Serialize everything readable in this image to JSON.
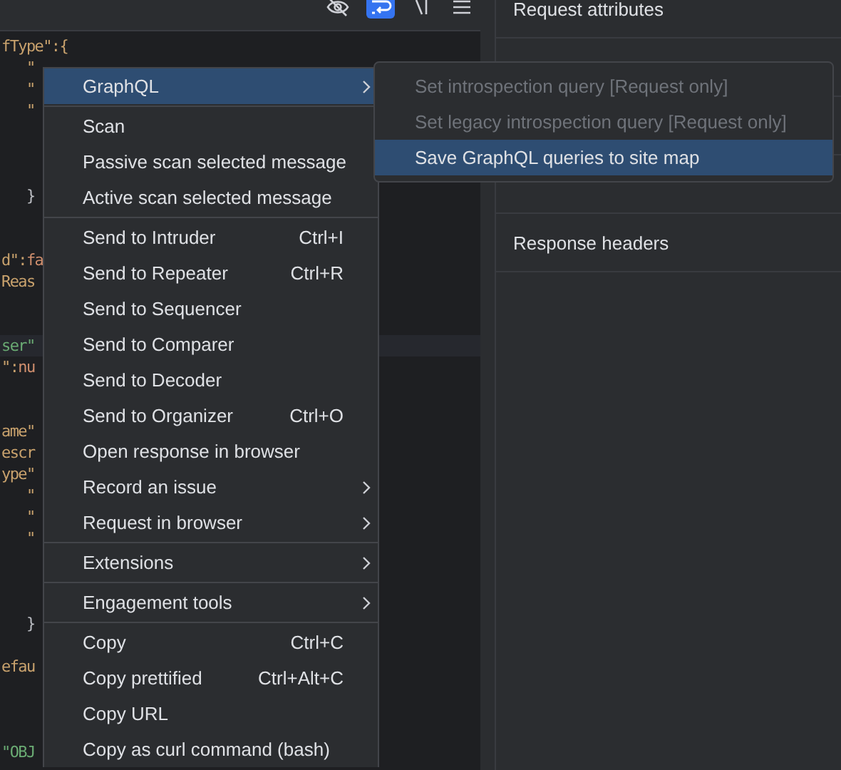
{
  "toolbar": [
    {
      "kind": "eye-off",
      "selected": false
    },
    {
      "kind": "wrap",
      "selected": true
    },
    {
      "kind": "newline",
      "selected": false
    },
    {
      "kind": "menu",
      "selected": false
    }
  ],
  "code_lines": [
    {
      "kind": "code",
      "current": false,
      "segments": [
        {
          "text": "fType\":{",
          "color": "#c9a26d"
        }
      ]
    },
    {
      "kind": "code",
      "current": false,
      "segments": [
        {
          "text": "   \"",
          "color": "#c9a26d"
        }
      ]
    },
    {
      "kind": "code",
      "current": false,
      "segments": [
        {
          "text": "   \"",
          "color": "#c9a26d"
        }
      ]
    },
    {
      "kind": "code",
      "current": false,
      "segments": [
        {
          "text": "   \"",
          "color": "#c9a26d"
        }
      ]
    },
    {
      "kind": "blank"
    },
    {
      "kind": "blank"
    },
    {
      "kind": "blank"
    },
    {
      "kind": "code",
      "current": false,
      "segments": [
        {
          "text": "   }",
          "color": "#bcbec4"
        }
      ]
    },
    {
      "kind": "blank"
    },
    {
      "kind": "blank"
    },
    {
      "kind": "code",
      "current": false,
      "segments": [
        {
          "text": "d\":",
          "color": "#c9a26d"
        },
        {
          "text": "fa",
          "color": "#cf8e6d"
        }
      ]
    },
    {
      "kind": "code",
      "current": false,
      "segments": [
        {
          "text": "Reas",
          "color": "#c9a26d"
        }
      ]
    },
    {
      "kind": "blank"
    },
    {
      "kind": "blank"
    },
    {
      "kind": "code",
      "current": true,
      "segments": [
        {
          "text": "ser\"",
          "color": "#6aab73"
        }
      ]
    },
    {
      "kind": "code",
      "current": false,
      "segments": [
        {
          "text": "\":",
          "color": "#c9a26d"
        },
        {
          "text": "nu",
          "color": "#cf8e6d"
        }
      ]
    },
    {
      "kind": "blank"
    },
    {
      "kind": "blank"
    },
    {
      "kind": "code",
      "current": false,
      "segments": [
        {
          "text": "ame\"",
          "color": "#c9a26d"
        }
      ]
    },
    {
      "kind": "code",
      "current": false,
      "segments": [
        {
          "text": "escr",
          "color": "#c9a26d"
        }
      ]
    },
    {
      "kind": "code",
      "current": false,
      "segments": [
        {
          "text": "ype\"",
          "color": "#c9a26d"
        }
      ]
    },
    {
      "kind": "code",
      "current": false,
      "segments": [
        {
          "text": "   \"",
          "color": "#c9a26d"
        }
      ]
    },
    {
      "kind": "code",
      "current": false,
      "segments": [
        {
          "text": "   \"",
          "color": "#c9a26d"
        }
      ]
    },
    {
      "kind": "code",
      "current": false,
      "segments": [
        {
          "text": "   \"",
          "color": "#c9a26d"
        }
      ]
    },
    {
      "kind": "blank"
    },
    {
      "kind": "blank"
    },
    {
      "kind": "blank"
    },
    {
      "kind": "code",
      "current": false,
      "segments": [
        {
          "text": "   }",
          "color": "#bcbec4"
        }
      ]
    },
    {
      "kind": "blank"
    },
    {
      "kind": "code",
      "current": false,
      "segments": [
        {
          "text": "efau",
          "color": "#c9a26d"
        }
      ]
    },
    {
      "kind": "blank"
    },
    {
      "kind": "blank"
    },
    {
      "kind": "blank"
    },
    {
      "kind": "code",
      "current": false,
      "segments": [
        {
          "text": "\"OBJ",
          "color": "#6aab73"
        }
      ]
    }
  ],
  "side_panel": {
    "rows": [
      {
        "kind": "label",
        "label": "Request attributes"
      },
      {
        "kind": "covered"
      },
      {
        "kind": "covered"
      },
      {
        "kind": "covered"
      },
      {
        "kind": "label",
        "label": "Response headers"
      }
    ]
  },
  "context_menu": {
    "groups": [
      [
        {
          "label": "GraphQL",
          "submenu": true,
          "selected": true
        }
      ],
      [
        {
          "label": "Scan",
          "submenu": false,
          "selected": false
        },
        {
          "label": "Passive scan selected message",
          "submenu": false,
          "selected": false
        },
        {
          "label": "Active scan selected message",
          "submenu": false,
          "selected": false
        }
      ],
      [
        {
          "label": "Send to Intruder",
          "shortcut": "Ctrl+I",
          "submenu": false,
          "selected": false
        },
        {
          "label": "Send to Repeater",
          "shortcut": "Ctrl+R",
          "submenu": false,
          "selected": false
        },
        {
          "label": "Send to Sequencer",
          "submenu": false,
          "selected": false
        },
        {
          "label": "Send to Comparer",
          "submenu": false,
          "selected": false
        },
        {
          "label": "Send to Decoder",
          "submenu": false,
          "selected": false
        },
        {
          "label": "Send to Organizer",
          "shortcut": "Ctrl+O",
          "submenu": false,
          "selected": false
        },
        {
          "label": "Open response in browser",
          "submenu": false,
          "selected": false
        },
        {
          "label": "Record an issue",
          "submenu": true,
          "selected": false
        },
        {
          "label": "Request in browser",
          "submenu": true,
          "selected": false
        }
      ],
      [
        {
          "label": "Extensions",
          "submenu": true,
          "selected": false
        }
      ],
      [
        {
          "label": "Engagement tools",
          "submenu": true,
          "selected": false
        }
      ],
      [
        {
          "label": "Copy",
          "shortcut": "Ctrl+C",
          "submenu": false,
          "selected": false
        },
        {
          "label": "Copy prettified",
          "shortcut": "Ctrl+Alt+C",
          "submenu": false,
          "selected": false
        },
        {
          "label": "Copy URL",
          "submenu": false,
          "selected": false
        },
        {
          "label": "Copy as curl command (bash)",
          "submenu": false,
          "selected": false
        }
      ]
    ]
  },
  "submenu": {
    "items": [
      {
        "label": "Set introspection query [Request only]",
        "disabled": true,
        "selected": false
      },
      {
        "label": "Set legacy introspection query [Request only]",
        "disabled": true,
        "selected": false
      },
      {
        "label": "Save GraphQL queries to site map",
        "disabled": false,
        "selected": true
      }
    ]
  }
}
